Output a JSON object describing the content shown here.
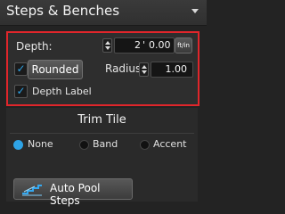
{
  "header": {
    "title": "Steps & Benches",
    "collapse_icon": "chevron-down-icon"
  },
  "panel": {
    "border_color": "#e0262b",
    "depth": {
      "label": "Depth:",
      "feet": "2",
      "separator": "'",
      "inches": "0.00",
      "unit_label": "ft/in"
    },
    "rounded": {
      "checked": true,
      "button_label": "Rounded"
    },
    "radius": {
      "label": "Radius:",
      "value": "1.00"
    },
    "depth_label": {
      "checked": true,
      "label": "Depth Label"
    }
  },
  "trim_tile": {
    "title": "Trim Tile",
    "options": [
      {
        "label": "None",
        "selected": true
      },
      {
        "label": "Band",
        "selected": false
      },
      {
        "label": "Accent",
        "selected": false
      }
    ]
  },
  "auto_pool_steps": {
    "label": "Auto Pool Steps",
    "icon": "steps-icon"
  },
  "colors": {
    "accent": "#2ea3e6",
    "highlight": "#e0262b"
  }
}
